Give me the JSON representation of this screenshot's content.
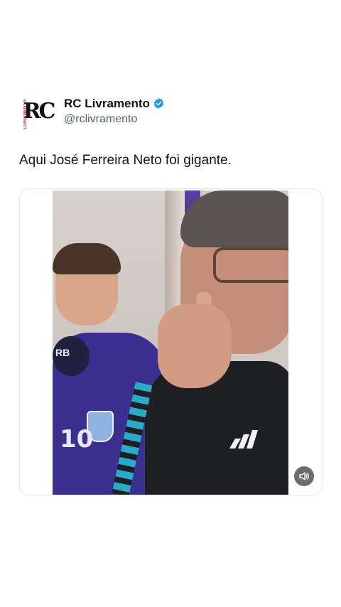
{
  "tweet": {
    "display_name": "RC Livramento",
    "handle": "@rclivramento",
    "verified": true,
    "text": "Aqui José Ferreira Neto foi gigante.",
    "avatar": {
      "logo_text": "RC",
      "side_text": "LIVRAMENTO"
    }
  },
  "media": {
    "type": "video",
    "overlay_texts": [
      "RB",
      "10"
    ],
    "controls": {
      "mute_icon": "volume-icon"
    }
  },
  "colors": {
    "verified_blue": "#1d9bf0",
    "handle_gray": "#536471",
    "text": "#0f1419"
  }
}
